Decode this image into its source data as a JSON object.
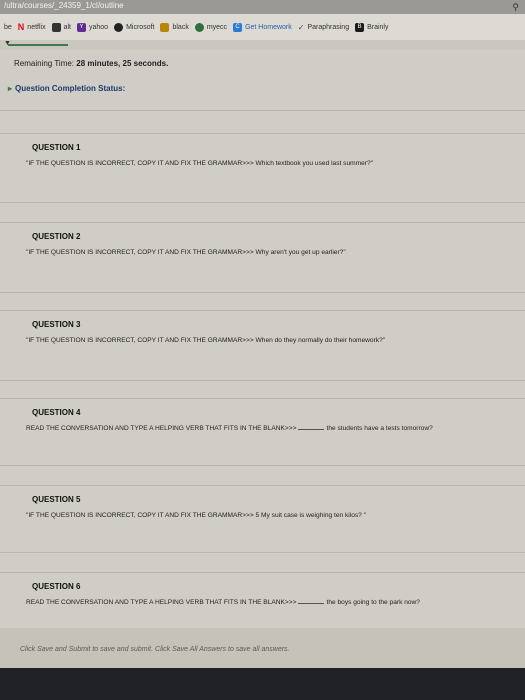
{
  "browser": {
    "url": "/ultra/courses/_24359_1/cl/outline",
    "bookmarks": [
      {
        "label": "be",
        "icon": "",
        "color": ""
      },
      {
        "label": "netflix",
        "icon": "N",
        "color": "#e50914"
      },
      {
        "label": "alt",
        "icon": "",
        "color": "#333333"
      },
      {
        "label": "yahoo",
        "icon": "Y",
        "color": "#5f2c91"
      },
      {
        "label": "Microsoft",
        "icon": "",
        "color": "#222222"
      },
      {
        "label": "black",
        "icon": "",
        "color": "#b8860b"
      },
      {
        "label": "myecc",
        "icon": "",
        "color": "#2f6f3a"
      },
      {
        "label": "Get Homework",
        "icon": "C",
        "color": "#2b7bd6"
      },
      {
        "label": "Paraphrasing",
        "icon": "",
        "color": "#4a4a4a"
      },
      {
        "label": "Brainly",
        "icon": "B",
        "color": "#1a1a1a"
      }
    ]
  },
  "timer": {
    "prefix": "Remaining Time:",
    "value": "28 minutes, 25 seconds."
  },
  "status": {
    "label": "Question Completion Status:"
  },
  "questions": [
    {
      "title": "QUESTION 1",
      "text": "\"IF THE QUESTION IS INCORRECT, COPY IT AND FIX THE GRAMMAR>>> Which textbook you used last summer?\""
    },
    {
      "title": "QUESTION 2",
      "text": "\"IF THE QUESTION IS INCORRECT, COPY IT AND FIX THE GRAMMAR>>> Why aren't you get up earlier?\""
    },
    {
      "title": "QUESTION 3",
      "text": "\"IF THE QUESTION IS INCORRECT, COPY IT AND FIX THE GRAMMAR>>> When do they normally do their homework?\""
    },
    {
      "title": "QUESTION 4",
      "before": "READ THE CONVERSATION AND TYPE A HELPING VERB THAT FITS IN THE BLANK>>>",
      "after": "the students have a tests tomorrow?"
    },
    {
      "title": "QUESTION 5",
      "text": "\"IF THE QUESTION IS INCORRECT, COPY IT AND FIX THE GRAMMAR>>> 5 My suit case is weighing ten kilos? \""
    },
    {
      "title": "QUESTION 6",
      "before": "READ THE CONVERSATION AND TYPE A HELPING VERB THAT FITS IN THE BLANK>>>",
      "after": "the boys going to the park now?"
    }
  ],
  "footer": {
    "note": "Click Save and Submit to save and submit. Click Save All Answers to save all answers."
  }
}
